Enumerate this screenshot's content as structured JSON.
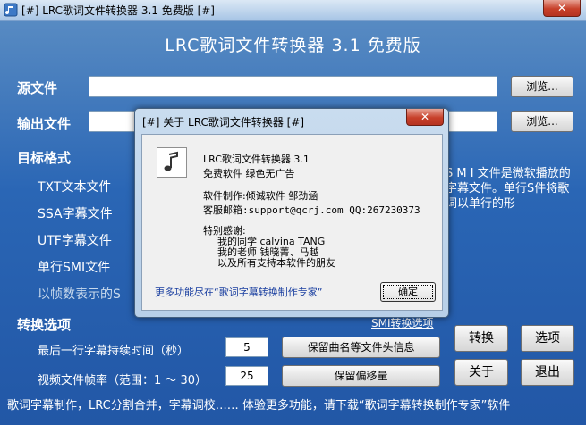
{
  "window": {
    "title": "[#] LRC歌词文件转换器 3.1 免费版 [#]",
    "close_label": "✕"
  },
  "banner": "LRC歌词文件转换器 3.1 免费版",
  "source": {
    "label": "源文件",
    "value": "",
    "browse_label": "浏览..."
  },
  "output": {
    "label": "输出文件",
    "value": "",
    "browse_label": "浏览..."
  },
  "target_format": {
    "label": "目标格式",
    "options": [
      "TXT文本文件",
      "SSA字幕文件",
      "UTF字幕文件",
      "单行SMI文件",
      "以帧数表示的S"
    ]
  },
  "smi_description": "S M I 文件是微软播放的字幕文件。单行S件将歌词以单行的形",
  "smi_link": "SMI转换选项",
  "convert_options": {
    "label": "转换选项",
    "last_line_label": "最后一行字幕持续时间（秒）",
    "last_line_value": "5",
    "fps_label": "视频文件帧率（范围：1 ～ 30）",
    "fps_value": "25",
    "keep_header_label": "保留曲名等文件头信息",
    "keep_offset_label": "保留偏移量"
  },
  "buttons": {
    "convert": "转换",
    "options": "选项",
    "about": "关于",
    "exit": "退出"
  },
  "status_bar": "歌词字幕制作，LRC分割合并，字幕调校…… 体验更多功能，请下载“歌词字幕转换制作专家”软件",
  "about_dialog": {
    "title": "[#] 关于 LRC歌词文件转换器 [#]",
    "close_label": "✕",
    "app_name": "LRC歌词文件转换器 3.1",
    "license": "免费软件 绿色无广告",
    "author": "软件制作:倾诚软件 邹劲涵",
    "contact": "客服邮箱:support@qcrj.com  QQ:267230373",
    "thanks_title": "特别感谢:",
    "thanks": [
      "我的同学 calvina TANG",
      "我的老师 钱晓菁、马越",
      "以及所有支持本软件的朋友"
    ],
    "more_link": "更多功能尽在“歌词字幕转换制作专家”",
    "ok_label": "确定"
  }
}
